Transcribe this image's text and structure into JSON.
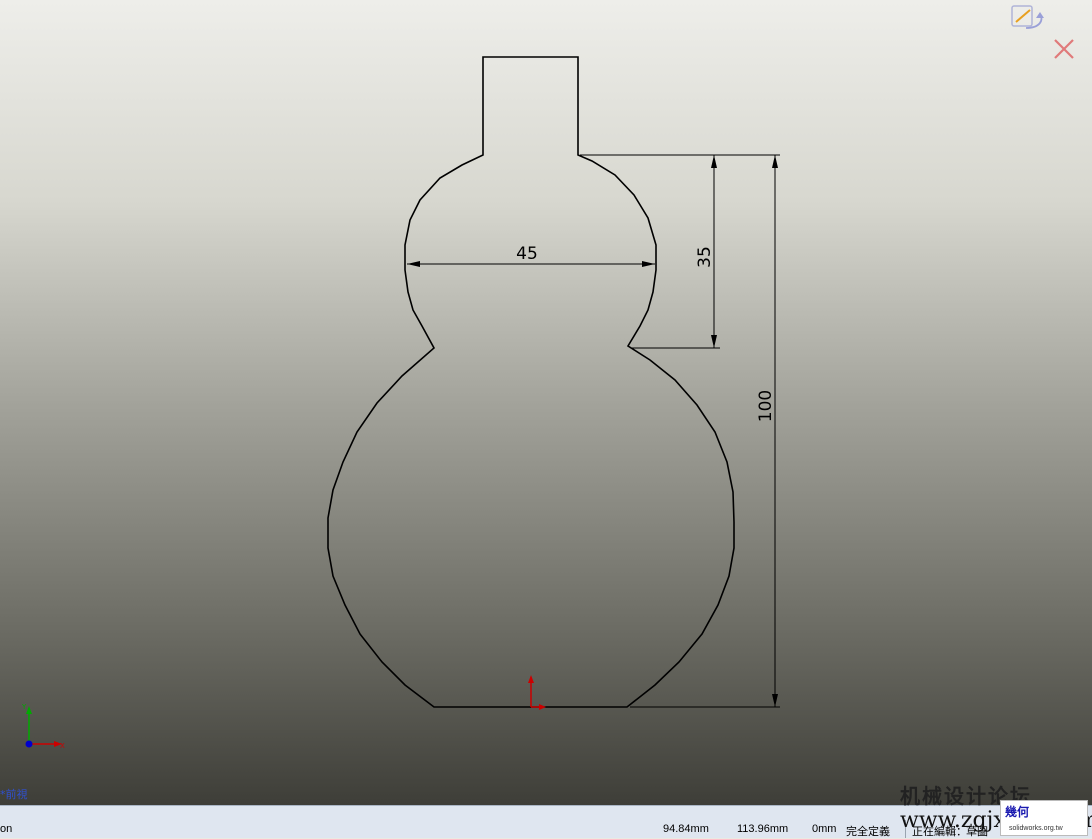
{
  "sketch": {
    "dimensions": {
      "width": "45",
      "upper_height": "35",
      "total_height": "100"
    },
    "view_label": "*前視"
  },
  "icons": {
    "confirm": "confirm-sketch-icon",
    "cancel": "cancel-sketch-icon",
    "triad": "coordinate-triad-icon",
    "origin": "sketch-origin-icon"
  },
  "status_bar": {
    "left_text": "on",
    "x_coord": "94.84mm",
    "y_coord": "113.96mm",
    "z_coord": "0mm",
    "state": "完全定義",
    "editing": "正在編輯：",
    "editing_target": "草圖"
  },
  "watermark": {
    "cn_text": "机械设计论坛",
    "url": "www.zgjxcad.com",
    "badge_text": "幾何",
    "badge_site": "solidworks.org.tw"
  },
  "colors": {
    "sketch_line": "#000000",
    "origin": "#cc0000",
    "cancel_icon": "#e07a7a",
    "triad_x": "#cc0000",
    "triad_y": "#00aa00",
    "triad_z": "#0000cc"
  }
}
